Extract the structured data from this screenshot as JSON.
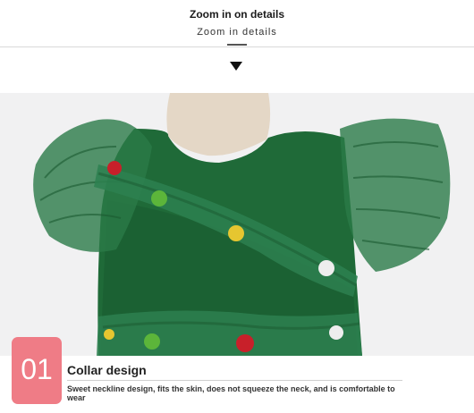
{
  "header": {
    "title": "Zoom in on details",
    "subtitle": "Zoom in details"
  },
  "feature": {
    "number": "01",
    "title": "Collar design",
    "description": "Sweet neckline design, fits the skin, does not squeeze the neck, and is comfortable to wear"
  },
  "colors": {
    "badge": "#ef7c86",
    "dress": "#1f6a38"
  },
  "icons": {
    "arrow": "down-triangle-icon"
  }
}
